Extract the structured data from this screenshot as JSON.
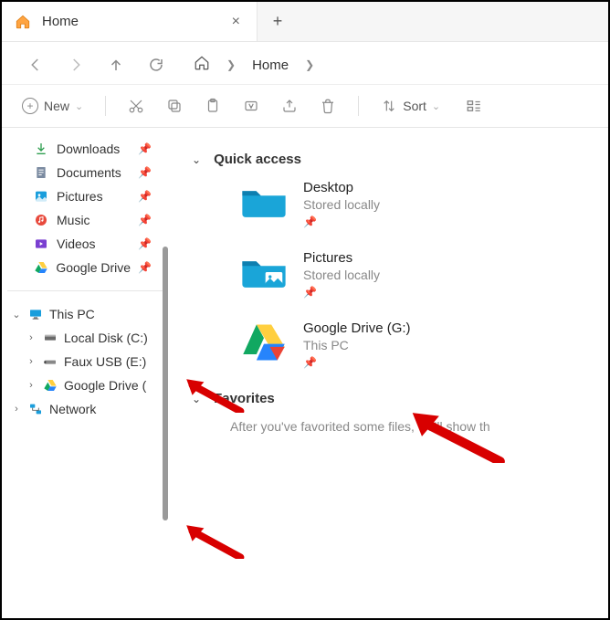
{
  "tabs": {
    "active_label": "Home"
  },
  "breadcrumb": {
    "location": "Home"
  },
  "toolbar": {
    "new_label": "New",
    "sort_label": "Sort"
  },
  "sidebar": {
    "quick": [
      {
        "label": "Downloads",
        "pinned": true,
        "icon": "download"
      },
      {
        "label": "Documents",
        "pinned": true,
        "icon": "document"
      },
      {
        "label": "Pictures",
        "pinned": true,
        "icon": "pictures"
      },
      {
        "label": "Music",
        "pinned": true,
        "icon": "music"
      },
      {
        "label": "Videos",
        "pinned": true,
        "icon": "videos"
      },
      {
        "label": "Google Drive",
        "pinned": true,
        "icon": "gdrive"
      }
    ],
    "tree": {
      "this_pc": "This PC",
      "children": [
        {
          "label": "Local Disk (C:)",
          "icon": "disk"
        },
        {
          "label": "Faux USB (E:)",
          "icon": "usb"
        },
        {
          "label": "Google Drive (",
          "icon": "gdrive"
        }
      ],
      "network": "Network"
    }
  },
  "content": {
    "quick_access": {
      "title": "Quick access",
      "items": [
        {
          "name": "Desktop",
          "sub": "Stored locally",
          "icon": "folder"
        },
        {
          "name": "Pictures",
          "sub": "Stored locally",
          "icon": "pictures-folder"
        },
        {
          "name": "Google Drive (G:)",
          "sub": "This PC",
          "icon": "gdrive"
        }
      ]
    },
    "favorites": {
      "title": "Favorites",
      "empty_text": "After you've favorited some files, we'll show th"
    }
  }
}
